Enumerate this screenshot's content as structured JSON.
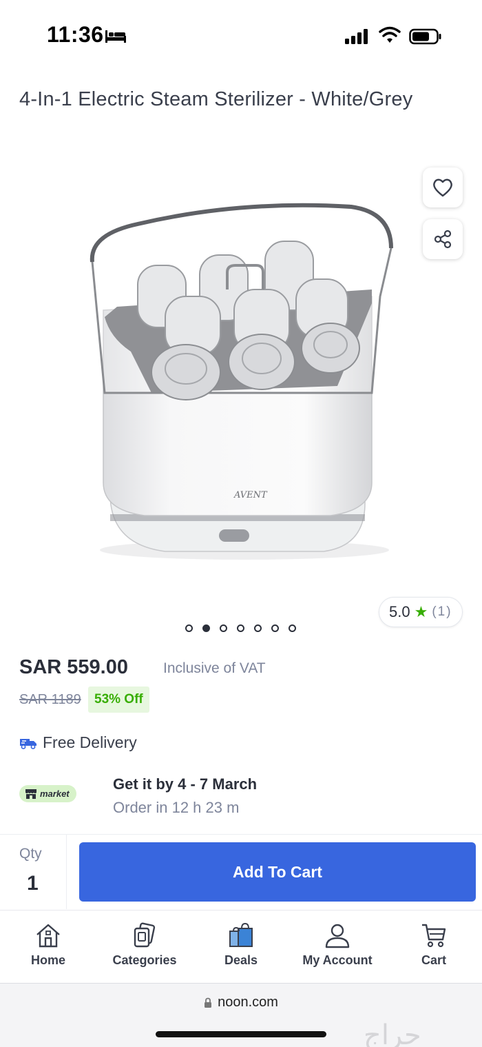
{
  "status_bar": {
    "time": "11:36"
  },
  "product": {
    "title": "4-In-1 Electric Steam Sterilizer - White/Grey",
    "image_brand_mark": "AVENT",
    "rating": "5.0",
    "rating_count": "(1)",
    "gallery_dots": 7,
    "gallery_active_index": 1
  },
  "pricing": {
    "price": "SAR 559.00",
    "vat_note": "Inclusive of VAT",
    "old_price": "SAR 1189",
    "discount": "53% Off"
  },
  "delivery": {
    "free_delivery": "Free Delivery",
    "market_badge": "market",
    "get_it": "Get it by 4 - 7 March",
    "order_in": "Order in 12 h 23 m"
  },
  "cart_bar": {
    "qty_label": "Qty",
    "qty_value": "1",
    "add_to_cart": "Add To Cart"
  },
  "bottom_nav": {
    "items": [
      {
        "label": "Home",
        "icon": "home-icon"
      },
      {
        "label": "Categories",
        "icon": "categories-icon"
      },
      {
        "label": "Deals",
        "icon": "deals-bag-icon"
      },
      {
        "label": "My Account",
        "icon": "account-icon"
      },
      {
        "label": "Cart",
        "icon": "cart-icon"
      }
    ]
  },
  "browser": {
    "url": "noon.com"
  },
  "watermark": "حراج",
  "colors": {
    "accent_blue": "#3866df",
    "discount_green": "#38ae04",
    "discount_bg": "#e7f7df",
    "market_bg": "#d7f2c9",
    "text_dark": "#2b2f3a",
    "text_muted": "#7e859b"
  }
}
